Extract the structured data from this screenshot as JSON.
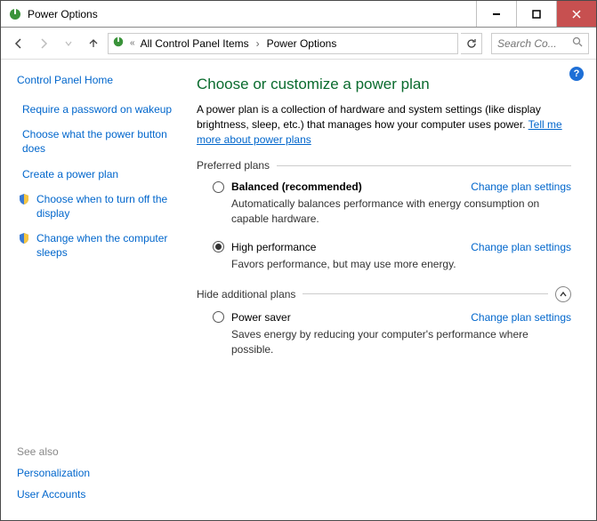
{
  "window": {
    "title": "Power Options"
  },
  "breadcrumb": {
    "item1": "All Control Panel Items",
    "item2": "Power Options"
  },
  "search": {
    "placeholder": "Search Co..."
  },
  "sidebar": {
    "home": "Control Panel Home",
    "links": {
      "require_password": "Require a password on wakeup",
      "power_button": "Choose what the power button does",
      "create_plan": "Create a power plan",
      "turn_off_display": "Choose when to turn off the display",
      "computer_sleeps": "Change when the computer sleeps"
    },
    "see_also_head": "See also",
    "see_also": {
      "personalization": "Personalization",
      "user_accounts": "User Accounts"
    }
  },
  "main": {
    "title": "Choose or customize a power plan",
    "desc1": "A power plan is a collection of hardware and system settings (like display brightness, sleep, etc.) that manages how your computer uses power. ",
    "desc_link": "Tell me more about power plans",
    "preferred_head": "Preferred plans",
    "hide_head": "Hide additional plans",
    "change_link": "Change plan settings",
    "plans": {
      "balanced": {
        "name": "Balanced (recommended)",
        "desc": "Automatically balances performance with energy consumption on capable hardware."
      },
      "high": {
        "name": "High performance",
        "desc": "Favors performance, but may use more energy."
      },
      "saver": {
        "name": "Power saver",
        "desc": "Saves energy by reducing your computer's performance where possible."
      }
    }
  }
}
